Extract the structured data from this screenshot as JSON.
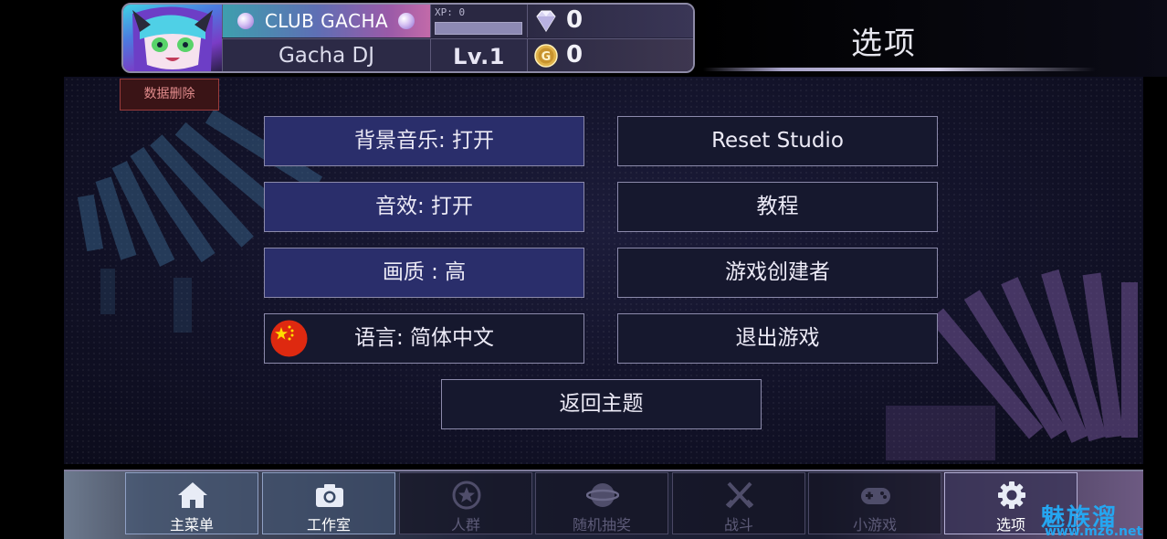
{
  "header": {
    "page_title": "选项",
    "club_label": "CLUB GACHA",
    "player_name": "Gacha DJ",
    "xp_label": "XP: 0",
    "xp_progress": 0,
    "level_label": "Lv.1",
    "gems": "0",
    "gold": "0"
  },
  "actions": {
    "delete_data": "数据删除"
  },
  "options": {
    "bgm": "背景音乐: 打开",
    "sfx": "音效: 打开",
    "quality": "画质 : 高",
    "language": "语言: 简体中文",
    "reset_studio": "Reset Studio",
    "tutorial": "教程",
    "credits": "游戏创建者",
    "exit_game": "退出游戏",
    "back_to_title": "返回主题"
  },
  "nav": {
    "items": [
      {
        "label": "主菜单",
        "icon": "home-icon",
        "state": "active"
      },
      {
        "label": "工作室",
        "icon": "camera-icon",
        "state": "active"
      },
      {
        "label": "人群",
        "icon": "star-icon",
        "state": "disabled"
      },
      {
        "label": "随机抽奖",
        "icon": "orb-icon",
        "state": "disabled"
      },
      {
        "label": "战斗",
        "icon": "crossed-swords-icon",
        "state": "disabled"
      },
      {
        "label": "小游戏",
        "icon": "gamepad-icon",
        "state": "disabled"
      },
      {
        "label": "选项",
        "icon": "gear-icon",
        "state": "selected"
      }
    ]
  },
  "watermark": {
    "title": "魅族溜",
    "url": "www.mz6.net"
  },
  "colors": {
    "button_blue": "#2a2e6b",
    "button_dark": "#16182e",
    "delete_red": "#3a1416",
    "watermark_blue": "#25a6f0"
  }
}
